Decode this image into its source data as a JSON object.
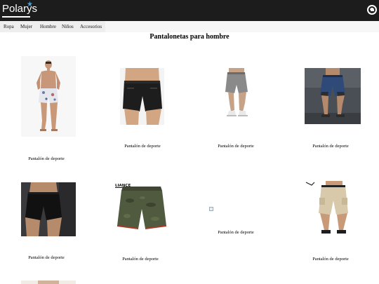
{
  "brand": {
    "logo_text": "Polarys",
    "logo_star": "★"
  },
  "header": {
    "account_icon": "account-circle-icon"
  },
  "nav": {
    "items": [
      {
        "label": "Ropa"
      },
      {
        "label": "Mujer"
      },
      {
        "label": "Hombre"
      },
      {
        "label": "Niños"
      },
      {
        "label": "Accesorios"
      }
    ]
  },
  "page": {
    "title": "Pantalonetas para hombre"
  },
  "products": [
    {
      "label": "Pantalón de deporte",
      "image": "man-white-floral-swim-shorts"
    },
    {
      "label": "Pantalón de deporte",
      "image": "black-athletic-shorts"
    },
    {
      "label": "Pantalón de deporte",
      "image": "grey-jogger-shorts"
    },
    {
      "label": "Pantalón de deporte",
      "image": "blue-compression-shorts"
    },
    {
      "label": "Pantalón de deporte",
      "image": "black-running-shorts-gym"
    },
    {
      "label": "Pantalón de deporte",
      "image": "olive-camo-shorts",
      "brand_tag": "LIANCE"
    },
    {
      "label": "Pantalón de deporte",
      "image": "broken-image"
    },
    {
      "label": "Pantalón de deporte",
      "image": "beige-cargo-shorts"
    }
  ],
  "colors": {
    "topbar": "#1c1c1c",
    "nav_bg": "#eeeeee",
    "accent_star": "#4aa3df"
  }
}
